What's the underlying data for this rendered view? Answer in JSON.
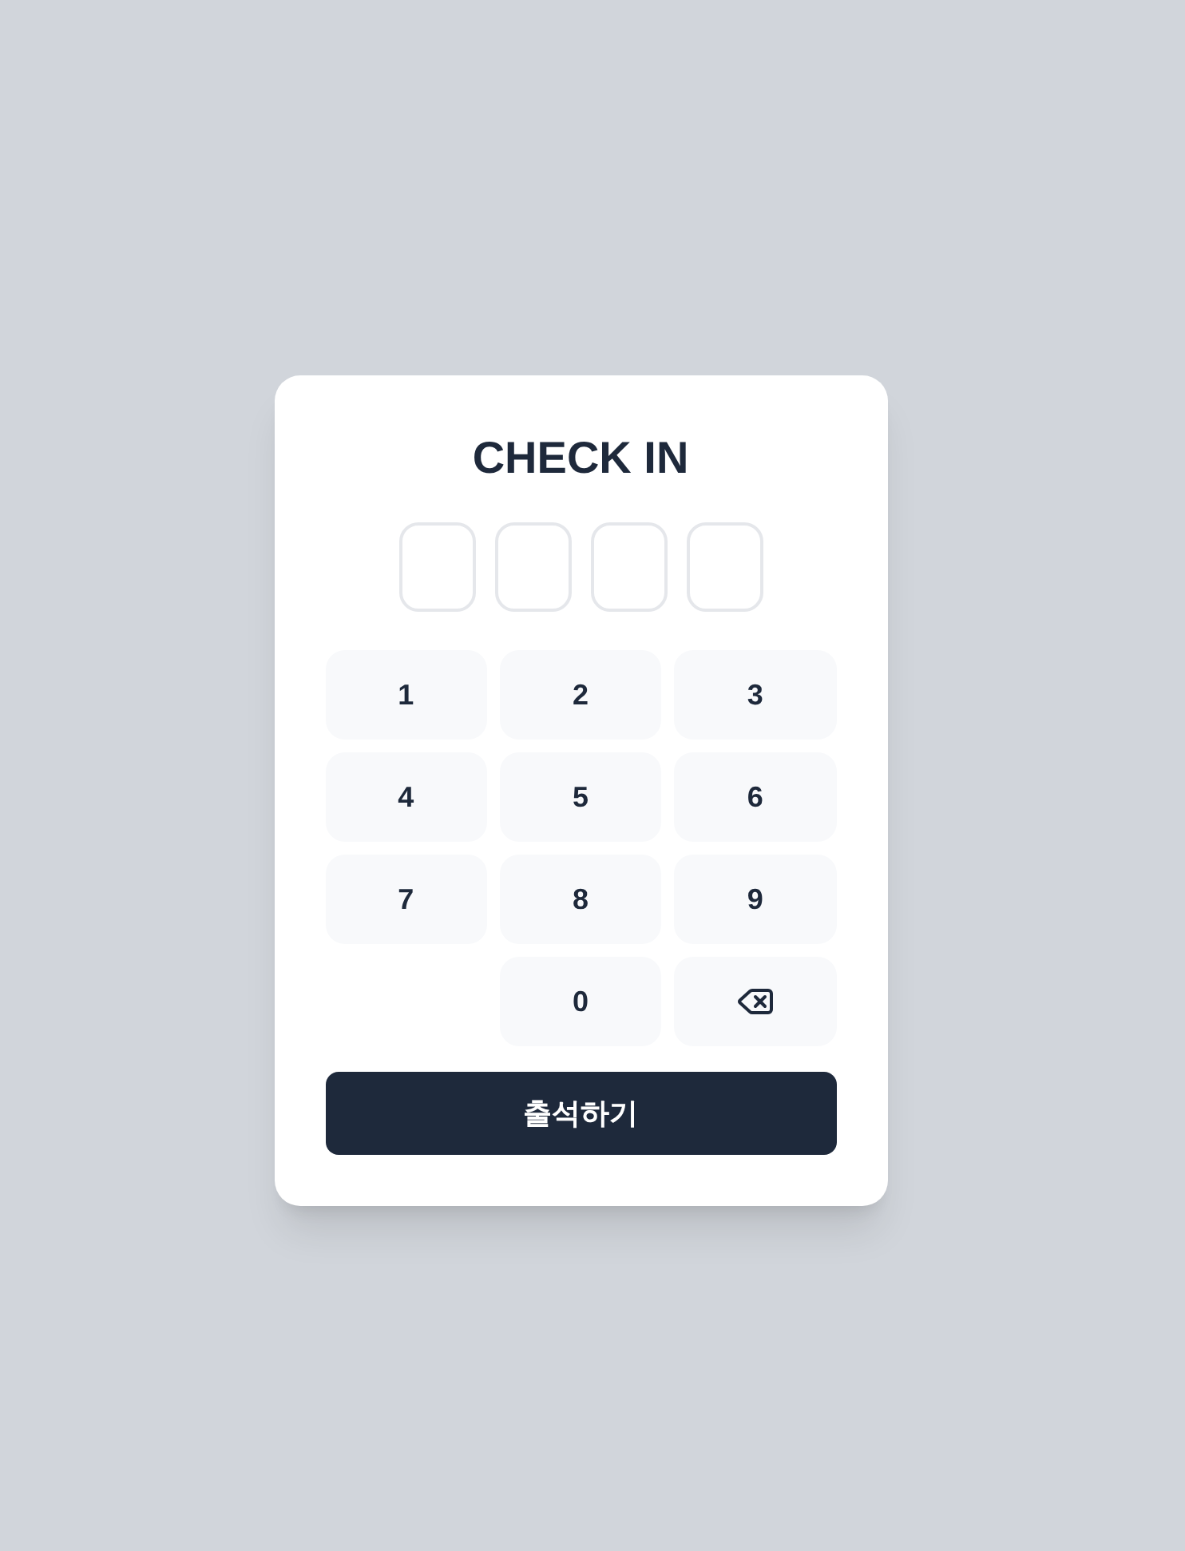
{
  "title": "CHECK IN",
  "code_slots": [
    {
      "filled": false
    },
    {
      "filled": false
    },
    {
      "filled": false
    },
    {
      "filled": false
    }
  ],
  "keypad": [
    {
      "kind": "digit",
      "label": "1"
    },
    {
      "kind": "digit",
      "label": "2"
    },
    {
      "kind": "digit",
      "label": "3"
    },
    {
      "kind": "digit",
      "label": "4"
    },
    {
      "kind": "digit",
      "label": "5"
    },
    {
      "kind": "digit",
      "label": "6"
    },
    {
      "kind": "digit",
      "label": "7"
    },
    {
      "kind": "digit",
      "label": "8"
    },
    {
      "kind": "digit",
      "label": "9"
    },
    {
      "kind": "blank"
    },
    {
      "kind": "digit",
      "label": "0"
    },
    {
      "kind": "backspace"
    }
  ],
  "submit_button": "출석하기"
}
